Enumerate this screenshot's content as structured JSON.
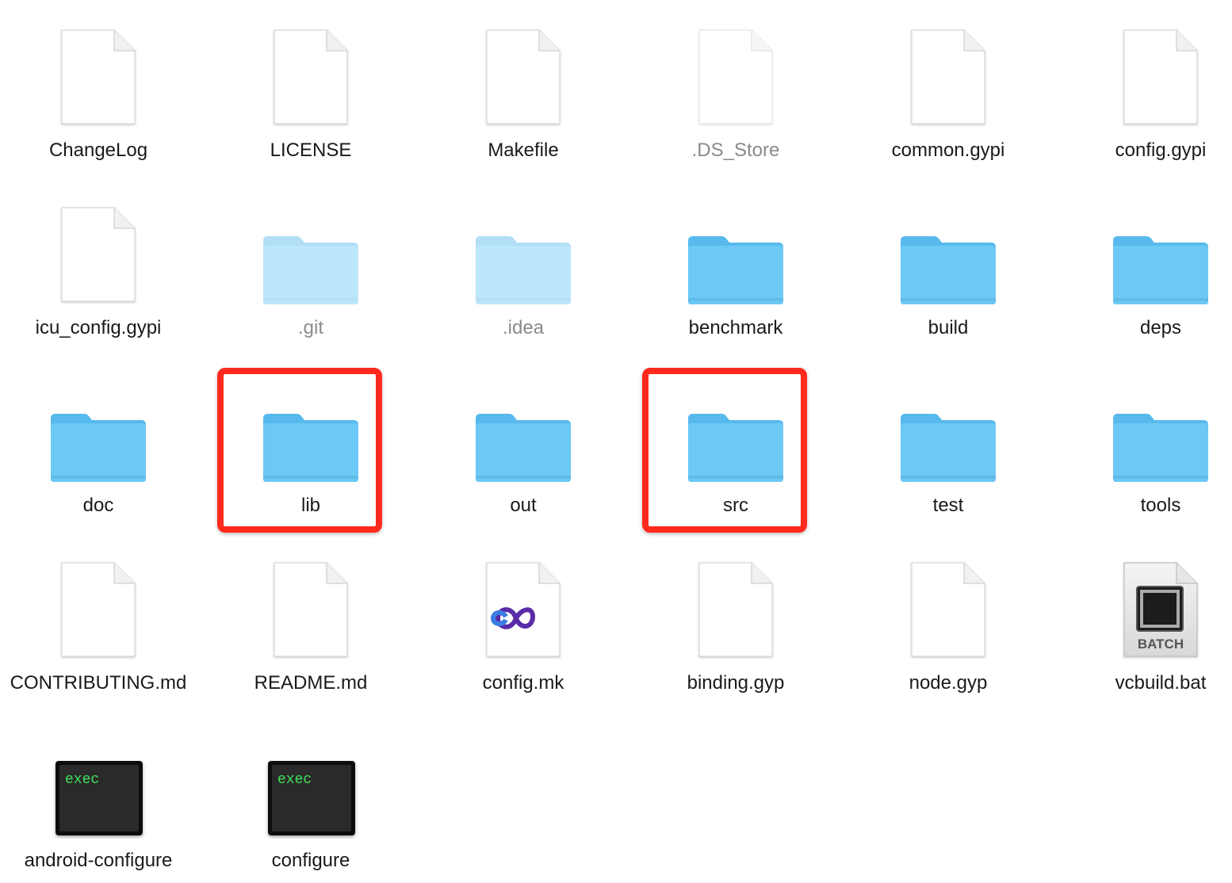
{
  "columns": 6,
  "items": [
    {
      "name": "ChangeLog",
      "kind": "doc"
    },
    {
      "name": "LICENSE",
      "kind": "doc"
    },
    {
      "name": "Makefile",
      "kind": "doc"
    },
    {
      "name": ".DS_Store",
      "kind": "doc",
      "hidden": true
    },
    {
      "name": "common.gypi",
      "kind": "doc"
    },
    {
      "name": "config.gypi",
      "kind": "doc"
    },
    {
      "name": "icu_config.gypi",
      "kind": "doc"
    },
    {
      "name": ".git",
      "kind": "folder",
      "hidden": true
    },
    {
      "name": ".idea",
      "kind": "folder",
      "hidden": true
    },
    {
      "name": "benchmark",
      "kind": "folder"
    },
    {
      "name": "build",
      "kind": "folder"
    },
    {
      "name": "deps",
      "kind": "folder"
    },
    {
      "name": "doc",
      "kind": "folder"
    },
    {
      "name": "lib",
      "kind": "folder",
      "highlighted": true
    },
    {
      "name": "out",
      "kind": "folder"
    },
    {
      "name": "src",
      "kind": "folder",
      "highlighted": true
    },
    {
      "name": "test",
      "kind": "folder"
    },
    {
      "name": "tools",
      "kind": "folder"
    },
    {
      "name": "CONTRIBUTING.md",
      "kind": "doc"
    },
    {
      "name": "README.md",
      "kind": "doc"
    },
    {
      "name": "config.mk",
      "kind": "vs"
    },
    {
      "name": "binding.gyp",
      "kind": "doc"
    },
    {
      "name": "node.gyp",
      "kind": "doc"
    },
    {
      "name": "vcbuild.bat",
      "kind": "batch",
      "badge": "BATCH"
    },
    {
      "name": "android-configure",
      "kind": "exec",
      "badge": "exec"
    },
    {
      "name": "configure",
      "kind": "exec",
      "badge": "exec"
    }
  ],
  "colors": {
    "folder": "#6cc9f5",
    "highlight": "#ff2a1d",
    "exec_text": "#3fe25a",
    "hidden_label": "#8a8a8a"
  }
}
